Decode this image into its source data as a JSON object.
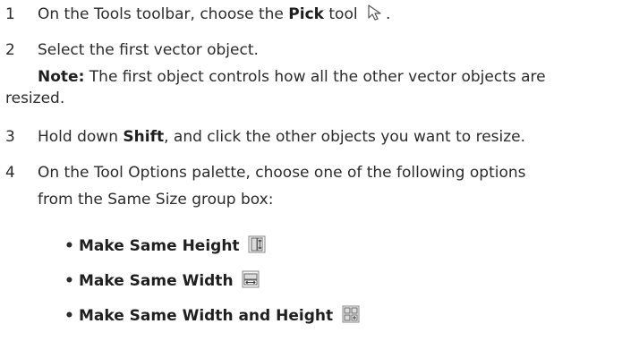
{
  "steps": [
    {
      "number": "1",
      "pre": "On the Tools toolbar, choose the ",
      "bold": "Pick",
      "post": " tool",
      "end": ".",
      "icon": "pick-arrow-icon"
    },
    {
      "number": "2",
      "text": "Select the first vector object."
    },
    {
      "number": "3",
      "pre": "Hold down ",
      "bold": "Shift",
      "post": ", and click the other objects you want to resize."
    },
    {
      "number": "4",
      "line1": "On the Tool Options palette, choose one of the following options",
      "line2": "from the Same Size group box:"
    }
  ],
  "note": {
    "label": "Note:",
    "line1": " The first object controls how all the other vector objects are",
    "line2": "resized."
  },
  "options": [
    {
      "bullet": "•",
      "label": "Make Same Height",
      "icon": "same-height-icon"
    },
    {
      "bullet": "•",
      "label": "Make Same Width",
      "icon": "same-width-icon"
    },
    {
      "bullet": "•",
      "label": "Make Same Width and Height",
      "icon": "same-width-height-icon"
    }
  ]
}
